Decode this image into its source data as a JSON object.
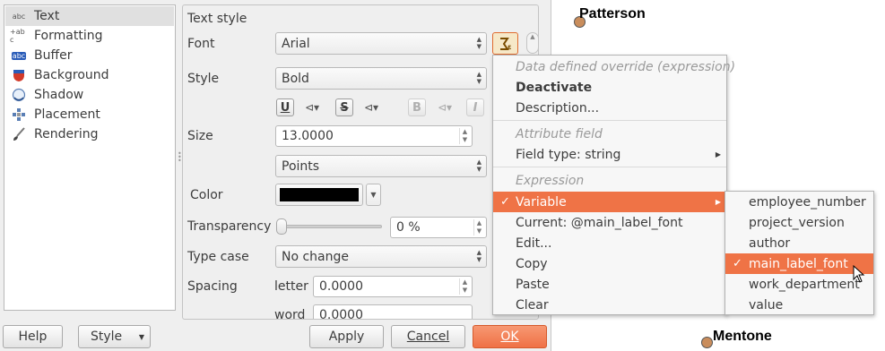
{
  "categories": [
    {
      "label": "Text",
      "icon": "abc"
    },
    {
      "label": "Formatting",
      "icon": "+ab c"
    },
    {
      "label": "Buffer",
      "icon": "abc"
    },
    {
      "label": "Background",
      "icon": "background-shield-icon"
    },
    {
      "label": "Shadow",
      "icon": "shadow-icon"
    },
    {
      "label": "Placement",
      "icon": "placement-icon"
    },
    {
      "label": "Rendering",
      "icon": "brush-icon"
    }
  ],
  "panel": {
    "title": "Text style",
    "font_label": "Font",
    "font_value": "Arial",
    "style_label": "Style",
    "style_value": "Bold",
    "underline": "U",
    "strike": "S",
    "bold": "B",
    "italic": "I",
    "size_label": "Size",
    "size_value": "13.0000",
    "unit_value": "Points",
    "color_label": "Color",
    "color_value": "#000000",
    "transparency_label": "Transparency",
    "transparency_value": "0 %",
    "transparency_level": 0,
    "typecase_label": "Type case",
    "typecase_value": "No change",
    "spacing_label": "Spacing",
    "letter_label": "letter",
    "letter_value": "0.0000",
    "word_label": "word",
    "word_value": "0.0000"
  },
  "buttons": {
    "help": "Help",
    "style": "Style",
    "apply": "Apply",
    "cancel": "Cancel",
    "ok": "OK"
  },
  "menu": {
    "header_ddo": "Data defined override (expression)",
    "deactivate": "Deactivate",
    "description": "Description...",
    "header_attr": "Attribute field",
    "field_type": "Field type: string",
    "header_expr": "Expression",
    "variable": "Variable",
    "current": "Current: @main_label_font",
    "edit": "Edit...",
    "copy": "Copy",
    "paste": "Paste",
    "clear": "Clear"
  },
  "submenu": [
    "employee_number",
    "project_version",
    "author",
    "main_label_font",
    "work_department",
    "value"
  ],
  "submenu_selected": "main_label_font",
  "map": {
    "city_top": "Patterson",
    "city_bottom": "Mentone"
  },
  "accent_color": "#ef7346"
}
